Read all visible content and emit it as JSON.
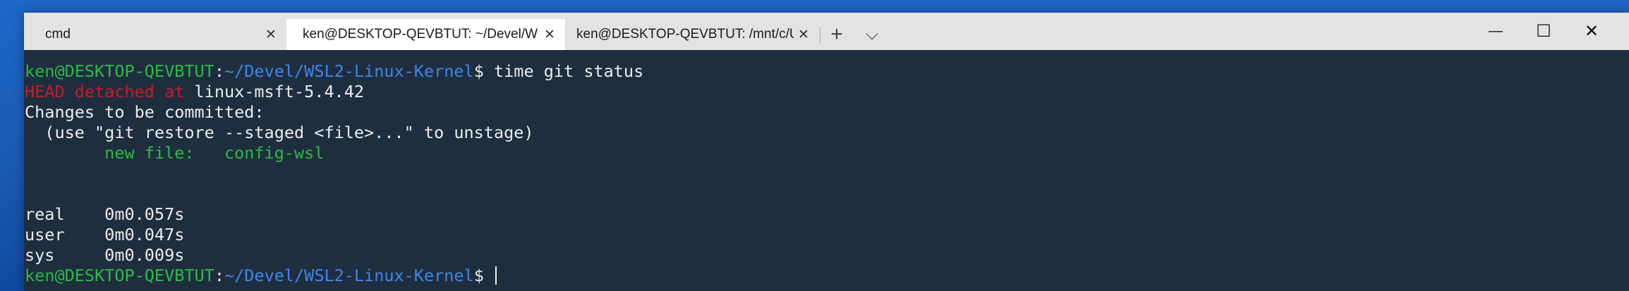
{
  "tabs": [
    {
      "label": "cmd",
      "active": false
    },
    {
      "label": "ken@DESKTOP-QEVBTUT: ~/Devel/W",
      "active": true
    },
    {
      "label": "ken@DESKTOP-QEVBTUT: /mnt/c/Us",
      "active": false
    }
  ],
  "tab_close_glyph": "✕",
  "new_tab_glyph": "+",
  "dropdown_glyph": "⌵",
  "window_controls": {
    "minimize": "—",
    "maximize": "☐",
    "close": "✕"
  },
  "colors": {
    "prompt_user": "#2bbb43",
    "prompt_path": "#3f86e8",
    "detached": "#c31c2b",
    "staged": "#2bbb43",
    "background": "#1f2e3f"
  },
  "terminal": {
    "prompt1": {
      "user_host": "ken@DESKTOP-QEVBTUT",
      "colon": ":",
      "path": "~/Devel/WSL2-Linux-Kernel",
      "symbol": "$",
      "command": " time git status"
    },
    "head_detached": "HEAD detached at",
    "head_ref": " linux-msft-5.4.42",
    "changes_header": "Changes to be committed:",
    "hint": "  (use \"git restore --staged <file>...\" to unstage)",
    "new_file": "        new file:   config-wsl",
    "timing": {
      "real": "real    0m0.057s",
      "user": "user    0m0.047s",
      "sys": "sys     0m0.009s"
    },
    "prompt2": {
      "user_host": "ken@DESKTOP-QEVBTUT",
      "colon": ":",
      "path": "~/Devel/WSL2-Linux-Kernel",
      "symbol": "$ "
    }
  }
}
